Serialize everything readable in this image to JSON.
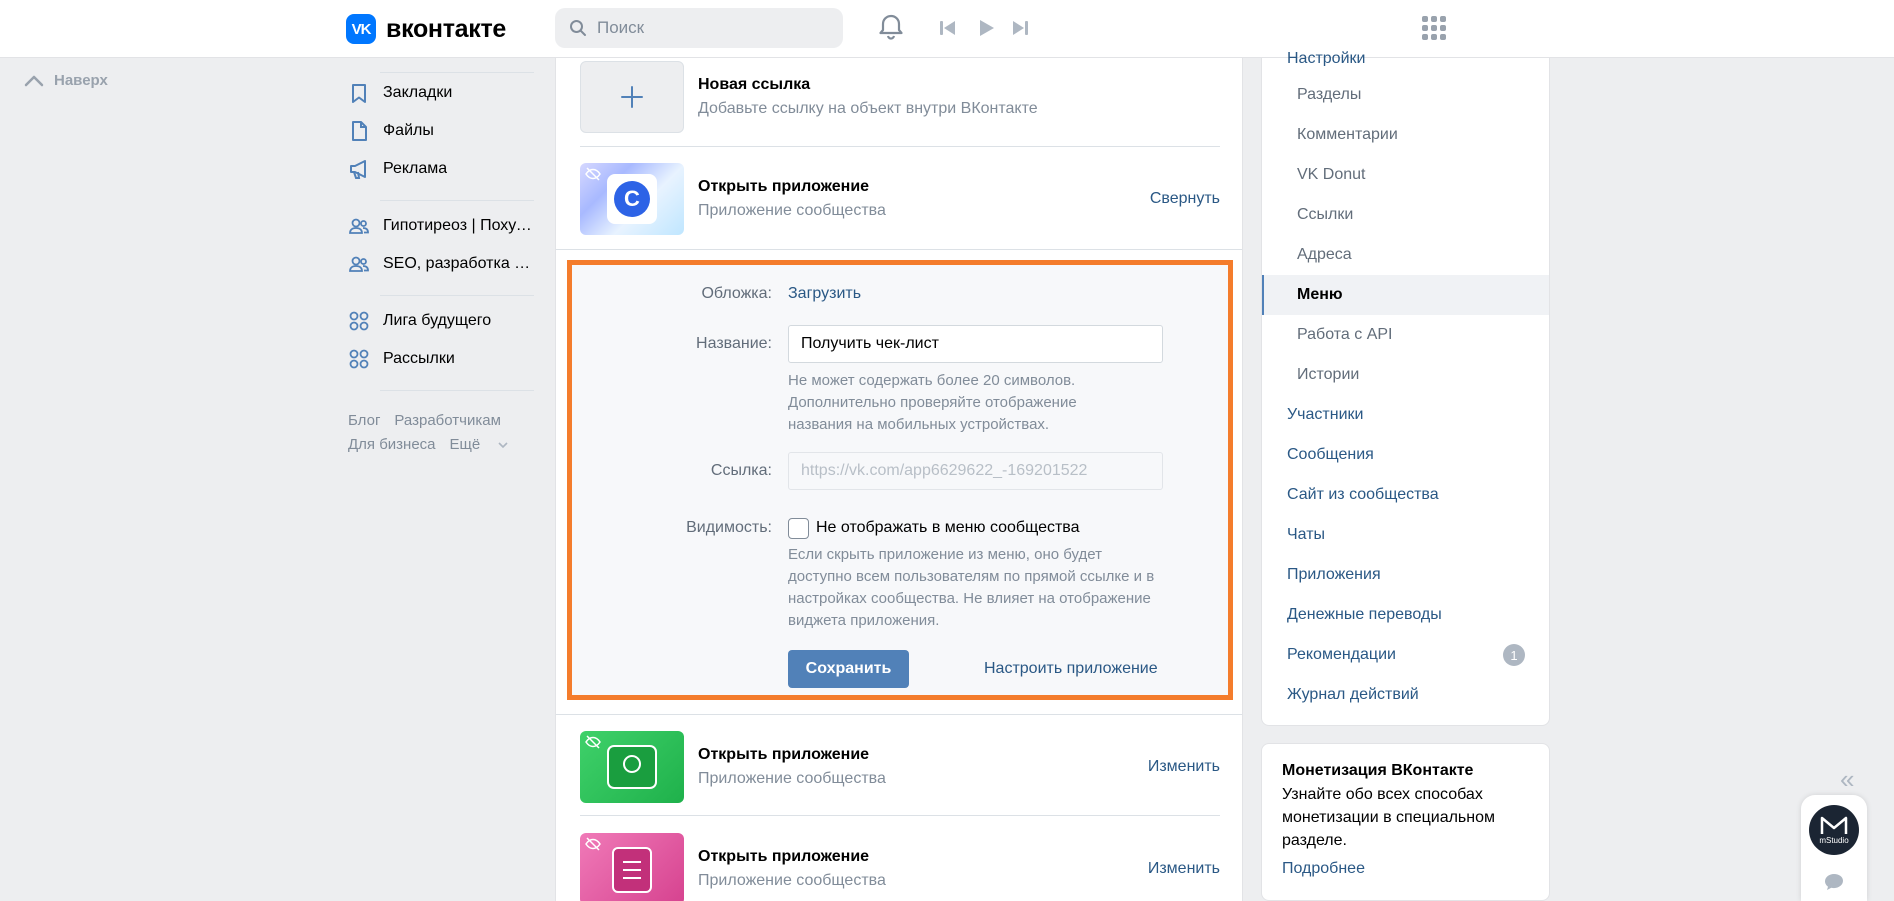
{
  "header": {
    "logo_badge": "VK",
    "logo_text": "вконтакте",
    "search_placeholder": "Поиск"
  },
  "left_sidebar": {
    "back_to_top": "Наверх",
    "items": [
      {
        "label": "Закладки",
        "icon": "bookmark-icon"
      },
      {
        "label": "Файлы",
        "icon": "file-icon"
      },
      {
        "label": "Реклама",
        "icon": "megaphone-icon"
      },
      {
        "label": "Гипотиреоз | Похудение",
        "icon": "group-icon"
      },
      {
        "label": "SEO, разработка сайтов",
        "icon": "group-icon"
      },
      {
        "label": "Лига будущего",
        "icon": "apps-icon"
      },
      {
        "label": "Рассылки",
        "icon": "apps-icon"
      }
    ],
    "footer": {
      "blog": "Блог",
      "developers": "Разработчикам",
      "business": "Для бизнеса",
      "more": "Ещё"
    }
  },
  "center": {
    "new_link": {
      "title": "Новая ссылка",
      "subtitle": "Добавьте ссылку на объект внутри ВКонтакте"
    },
    "apps": [
      {
        "title": "Открыть приложение",
        "subtitle": "Приложение сообщества",
        "action": "Свернуть"
      },
      {
        "title": "Открыть приложение",
        "subtitle": "Приложение сообщества",
        "action": "Изменить"
      },
      {
        "title": "Открыть приложение",
        "subtitle": "Приложение сообщества",
        "action": "Изменить"
      }
    ],
    "edit_form": {
      "cover_label": "Обложка:",
      "cover_action": "Загрузить",
      "name_label": "Название:",
      "name_value": "Получить чек-лист",
      "name_hint": "Не может содержать более 20 символов. Дополнительно проверяйте отображение названия на мобильных устройствах.",
      "link_label": "Ссылка:",
      "link_placeholder": "https://vk.com/app6629622_-169201522",
      "visibility_label": "Видимость:",
      "visibility_checkbox": "Не отображать в меню сообщества",
      "visibility_checked": false,
      "visibility_hint": "Если скрыть приложение из меню, оно будет доступно всем пользователям по прямой ссылке и в настройках сообщества. Не влияет на отображение виджета приложения.",
      "save_button": "Сохранить",
      "configure_link": "Настроить приложение"
    }
  },
  "right_menu": {
    "cut_item": "Настройки",
    "items": [
      {
        "label": "Разделы",
        "level": "sub"
      },
      {
        "label": "Комментарии",
        "level": "sub"
      },
      {
        "label": "VK Donut",
        "level": "sub"
      },
      {
        "label": "Ссылки",
        "level": "sub"
      },
      {
        "label": "Адреса",
        "level": "sub"
      },
      {
        "label": "Меню",
        "level": "sub",
        "active": true
      },
      {
        "label": "Работа с API",
        "level": "sub"
      },
      {
        "label": "Истории",
        "level": "sub"
      },
      {
        "label": "Участники",
        "level": "top"
      },
      {
        "label": "Сообщения",
        "level": "top"
      },
      {
        "label": "Сайт из сообщества",
        "level": "top"
      },
      {
        "label": "Чаты",
        "level": "top"
      },
      {
        "label": "Приложения",
        "level": "top"
      },
      {
        "label": "Денежные переводы",
        "level": "top"
      },
      {
        "label": "Рекомендации",
        "level": "top",
        "badge": "1"
      },
      {
        "label": "Журнал действий",
        "level": "top"
      }
    ]
  },
  "promo": {
    "title": "Монетизация ВКонтакте",
    "text": "Узнайте обо всех способах монетизации в специальном разделе.",
    "link": "Подробнее"
  },
  "chat_widget": {
    "avatar_text": "mStudio"
  },
  "colors": {
    "accent": "#5181b8",
    "link": "#2a5885",
    "highlight_border": "#f47c2c",
    "vk_blue": "#0077ff"
  }
}
